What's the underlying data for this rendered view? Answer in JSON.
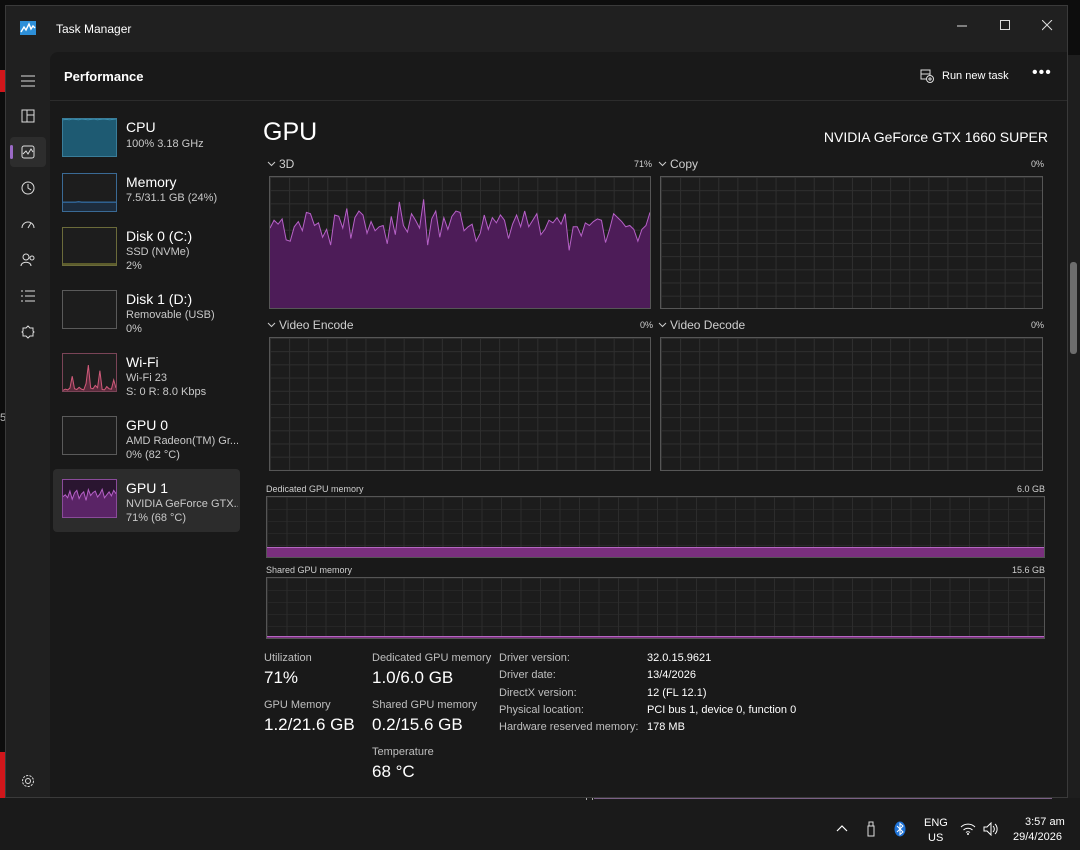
{
  "window": {
    "title": "Task Manager"
  },
  "nav": {
    "page_title": "Performance",
    "run_new_task": "Run new task",
    "more": "•••",
    "rail_items": [
      "hamburger-menu-icon",
      "processes-icon",
      "performance-icon",
      "app-history-icon",
      "startup-apps-icon",
      "users-icon",
      "details-icon",
      "services-icon",
      "settings-icon"
    ]
  },
  "sidebar": {
    "items": [
      {
        "name": "CPU",
        "sub1": "100%  3.18 GHz",
        "sub2": ""
      },
      {
        "name": "Memory",
        "sub1": "7.5/31.1 GB (24%)",
        "sub2": ""
      },
      {
        "name": "Disk 0 (C:)",
        "sub1": "SSD (NVMe)",
        "sub2": "2%"
      },
      {
        "name": "Disk 1 (D:)",
        "sub1": "Removable (USB)",
        "sub2": "0%"
      },
      {
        "name": "Wi-Fi",
        "sub1": "Wi-Fi 23",
        "sub2": "S: 0  R: 8.0 Kbps"
      },
      {
        "name": "GPU 0",
        "sub1": "AMD Radeon(TM) Gr...",
        "sub2": "0% (82 °C)"
      },
      {
        "name": "GPU 1",
        "sub1": "NVIDIA GeForce GTX...",
        "sub2": "71% (68 °C)"
      }
    ],
    "selected_index": 6
  },
  "main": {
    "title": "GPU",
    "model": "NVIDIA GeForce GTX 1660 SUPER",
    "engines": [
      {
        "label": "3D",
        "pct": "71%"
      },
      {
        "label": "Copy",
        "pct": "0%"
      },
      {
        "label": "Video Encode",
        "pct": "0%"
      },
      {
        "label": "Video Decode",
        "pct": "0%"
      }
    ],
    "dedicated_mem": {
      "label": "Dedicated GPU memory",
      "max": "6.0 GB",
      "fraction": 0.167
    },
    "shared_mem": {
      "label": "Shared GPU memory",
      "max": "15.6 GB",
      "fraction": 0.013
    },
    "utilization_series_3d": [
      61,
      67,
      64,
      68,
      52,
      51,
      62,
      66,
      59,
      73,
      72,
      63,
      65,
      54,
      60,
      48,
      71,
      70,
      61,
      76,
      53,
      69,
      74,
      71,
      57,
      66,
      59,
      62,
      63,
      49,
      70,
      56,
      81,
      63,
      58,
      72,
      67,
      61,
      83,
      48,
      68,
      74,
      54,
      69,
      60,
      70,
      74,
      73,
      59,
      62,
      64,
      51,
      57,
      71,
      60,
      69,
      65,
      71,
      67,
      53,
      64,
      71,
      62,
      74,
      62,
      67,
      72,
      56,
      60,
      67,
      65,
      69,
      64,
      72,
      44,
      62,
      62,
      55,
      65,
      63,
      66,
      68,
      67,
      50,
      60,
      72,
      69,
      66,
      62,
      63,
      60,
      51,
      60,
      63,
      73
    ],
    "stats": {
      "utilization_label": "Utilization",
      "utilization_value": "71%",
      "gpu_memory_label": "GPU Memory",
      "gpu_memory_value": "1.2/21.6 GB",
      "dedicated_label": "Dedicated GPU memory",
      "dedicated_value": "1.0/6.0 GB",
      "shared_label": "Shared GPU memory",
      "shared_value": "0.2/15.6 GB",
      "temperature_label": "Temperature",
      "temperature_value": "68 °C"
    },
    "info": [
      {
        "key": "Driver version:",
        "value": "32.0.15.9621"
      },
      {
        "key": "Driver date:",
        "value": "13/4/2026"
      },
      {
        "key": "DirectX version:",
        "value": "12 (FL 12.1)"
      },
      {
        "key": "Physical location:",
        "value": "PCI bus 1, device 0, function 0"
      },
      {
        "key": "Hardware reserved memory:",
        "value": "178 MB"
      }
    ]
  },
  "thumb_series": {
    "cpu": [
      98,
      99,
      98,
      100,
      99,
      98,
      100,
      99,
      98,
      99,
      100,
      98,
      99,
      100,
      99,
      98,
      99,
      100
    ],
    "memory": [
      24,
      24,
      24,
      24,
      24,
      25,
      24,
      24,
      24,
      24,
      24,
      24,
      24,
      24,
      24,
      24,
      24,
      24
    ],
    "wifi": [
      2,
      5,
      3,
      8,
      40,
      6,
      4,
      10,
      5,
      3,
      20,
      70,
      8,
      6,
      15,
      9,
      55,
      4,
      3,
      12,
      6,
      5,
      30,
      8
    ],
    "gpu1": [
      55,
      60,
      52,
      70,
      48,
      65,
      72,
      50,
      62,
      68,
      45,
      74,
      58,
      66,
      70,
      54,
      62,
      75,
      52,
      60,
      68,
      57,
      72,
      63
    ]
  },
  "taskbar": {
    "lang1": "ENG",
    "lang2": "US",
    "time": "3:57 am",
    "date": "29/4/2026"
  },
  "colors": {
    "gpu_accent": "#b661c7",
    "gpu_fill": "#4d1c58",
    "cpu_accent": "#3b8fb0",
    "wifi_accent": "#d05a7a"
  }
}
